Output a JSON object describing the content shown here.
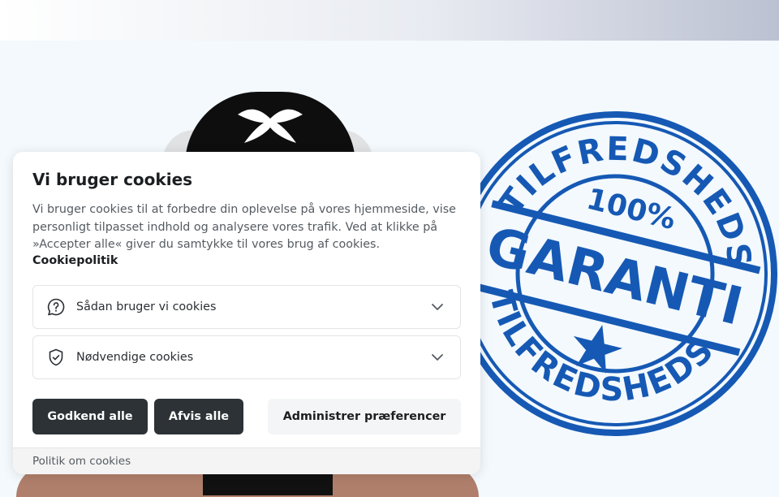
{
  "cookie_dialog": {
    "title": "Vi bruger cookies",
    "description": "Vi bruger cookies til at forbedre din oplevelse på vores hjemmeside, vise personligt tilpasset indhold og analysere vores trafik. Ved at klikke på »Accepter alle« giver du samtykke til vores brug af cookies.",
    "policy_link": "Cookiepolitik",
    "sections": [
      {
        "label": "Sådan bruger vi cookies",
        "icon": "question-icon"
      },
      {
        "label": "Nødvendige cookies",
        "icon": "shield-check-icon"
      }
    ],
    "buttons": {
      "accept_all": "Godkend alle",
      "reject_all": "Afvis alle",
      "manage_preferences": "Administrer præferencer"
    },
    "footer_link": "Politik om cookies"
  },
  "background": {
    "stamp": {
      "top_text": "TILFREDSHEDS",
      "percent": "100%",
      "center": "GARANTI",
      "bottom_text": "TILFREDSHEDS"
    }
  },
  "colors": {
    "stamp_blue": "#1659b4",
    "button_dark": "#2c3235",
    "page_bg": "#f3f9fd"
  }
}
